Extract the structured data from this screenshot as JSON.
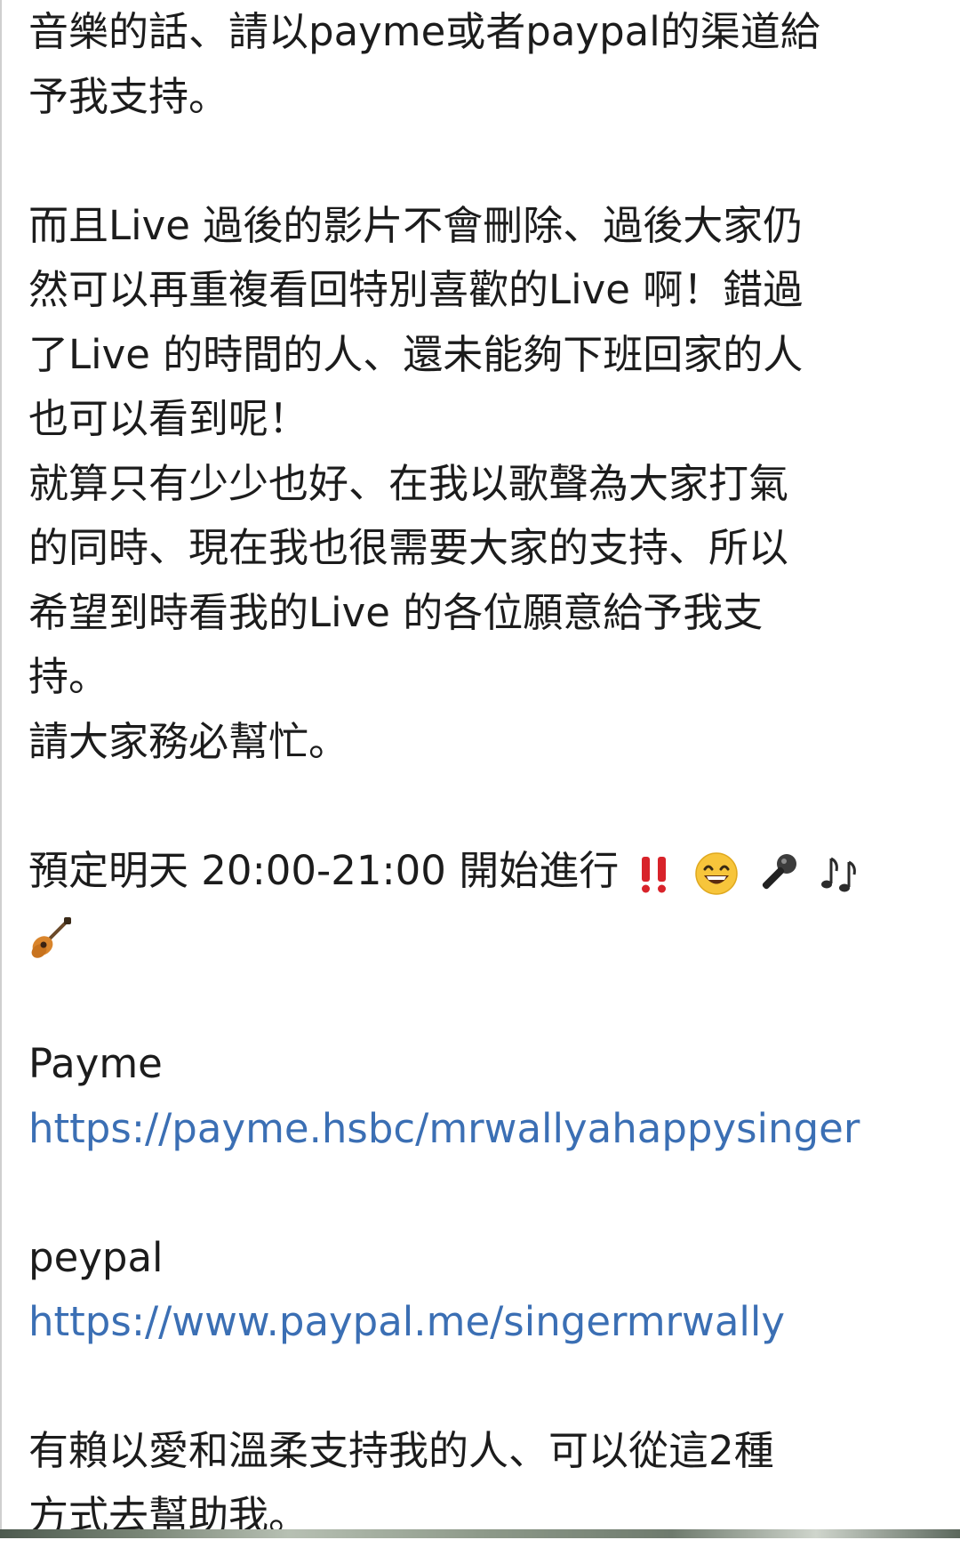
{
  "post": {
    "p1": {
      "line1": "音樂的話、請以payme或者paypal的渠道給",
      "line2": "予我支持。"
    },
    "p2": {
      "line1": "而且Live 過後的影片不會刪除、過後大家仍",
      "line2": "然可以再重複看回特別喜歡的Live 啊！錯過",
      "line3": "了Live 的時間的人、還未能夠下班回家的人",
      "line4": "也可以看到呢！",
      "line5": "就算只有少少也好、在我以歌聲為大家打氣",
      "line6": "的同時、現在我也很需要大家的支持、所以",
      "line7": "希望到時看我的Live 的各位願意給予我支",
      "line8": "持。",
      "line9": "請大家務必幫忙。"
    },
    "p3": {
      "text": "預定明天 20:00-21:00 開始進行",
      "emojis": [
        "double-exclamation-icon",
        "grinning-face-icon",
        "microphone-icon",
        "music-notes-icon",
        "guitar-icon"
      ]
    },
    "payme": {
      "label": "Payme",
      "url": "https://payme.hsbc/mrwallyahappysinger"
    },
    "paypal": {
      "label": "peypal",
      "url": "https://www.paypal.me/singermrwally"
    },
    "closing": {
      "line1": "有賴以愛和溫柔支持我的人、可以從這2種",
      "line2": "方式去幫助我。"
    }
  },
  "colors": {
    "text": "#1c1c1c",
    "link": "#3b6fb4",
    "background": "#ffffff"
  }
}
